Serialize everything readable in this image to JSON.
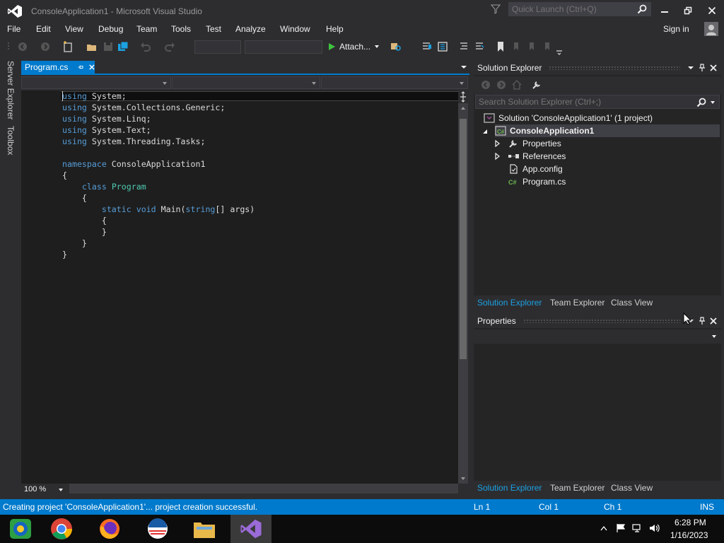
{
  "window": {
    "title": "ConsoleApplication1 - Microsoft Visual Studio",
    "quick_launch_placeholder": "Quick Launch (Ctrl+Q)"
  },
  "menu": {
    "items": [
      "File",
      "Edit",
      "View",
      "Debug",
      "Team",
      "Tools",
      "Test",
      "Analyze",
      "Window",
      "Help"
    ],
    "sign_in": "Sign in"
  },
  "toolbar": {
    "attach_label": "Attach..."
  },
  "left_strip": {
    "server_explorer": "Server Explorer",
    "toolbox": "Toolbox"
  },
  "document": {
    "tab_label": "Program.cs",
    "zoom": "100 %",
    "code": [
      [
        {
          "t": "using",
          "c": "kw"
        },
        {
          "t": " System;"
        }
      ],
      [
        {
          "t": "using",
          "c": "kw"
        },
        {
          "t": " System.Collections.Generic;"
        }
      ],
      [
        {
          "t": "using",
          "c": "kw"
        },
        {
          "t": " System.Linq;"
        }
      ],
      [
        {
          "t": "using",
          "c": "kw"
        },
        {
          "t": " System.Text;"
        }
      ],
      [
        {
          "t": "using",
          "c": "kw"
        },
        {
          "t": " System.Threading.Tasks;"
        }
      ],
      [],
      [
        {
          "t": "namespace",
          "c": "kw"
        },
        {
          "t": " ConsoleApplication1"
        }
      ],
      [
        {
          "t": "{"
        }
      ],
      [
        {
          "t": "    "
        },
        {
          "t": "class",
          "c": "kw"
        },
        {
          "t": " "
        },
        {
          "t": "Program",
          "c": "ty"
        }
      ],
      [
        {
          "t": "    {"
        }
      ],
      [
        {
          "t": "        "
        },
        {
          "t": "static",
          "c": "kw"
        },
        {
          "t": " "
        },
        {
          "t": "void",
          "c": "kw"
        },
        {
          "t": " Main("
        },
        {
          "t": "string",
          "c": "kw"
        },
        {
          "t": "[] args)"
        }
      ],
      [
        {
          "t": "        {"
        }
      ],
      [
        {
          "t": "        }"
        }
      ],
      [
        {
          "t": "    }"
        }
      ],
      [
        {
          "t": "}"
        }
      ]
    ]
  },
  "solution_explorer": {
    "title": "Solution Explorer",
    "search_placeholder": "Search Solution Explorer (Ctrl+;)",
    "solution": "Solution 'ConsoleApplication1' (1 project)",
    "project": "ConsoleApplication1",
    "items": {
      "properties": "Properties",
      "references": "References",
      "app_config": "App.config",
      "program_cs": "Program.cs"
    },
    "tabs": [
      "Solution Explorer",
      "Team Explorer",
      "Class View"
    ]
  },
  "properties_panel": {
    "title": "Properties",
    "tabs": [
      "Solution Explorer",
      "Team Explorer",
      "Class View"
    ]
  },
  "status": {
    "message": "Creating project 'ConsoleApplication1'... project creation successful.",
    "ln": "Ln 1",
    "col": "Col 1",
    "ch": "Ch 1",
    "mode": "INS"
  },
  "taskbar": {
    "time": "6:28 PM",
    "date": "1/16/2023"
  },
  "colors": {
    "accent": "#007acc",
    "keyword": "#569cd6",
    "type": "#4ec9b0",
    "editor_bg": "#1e1e1e"
  }
}
